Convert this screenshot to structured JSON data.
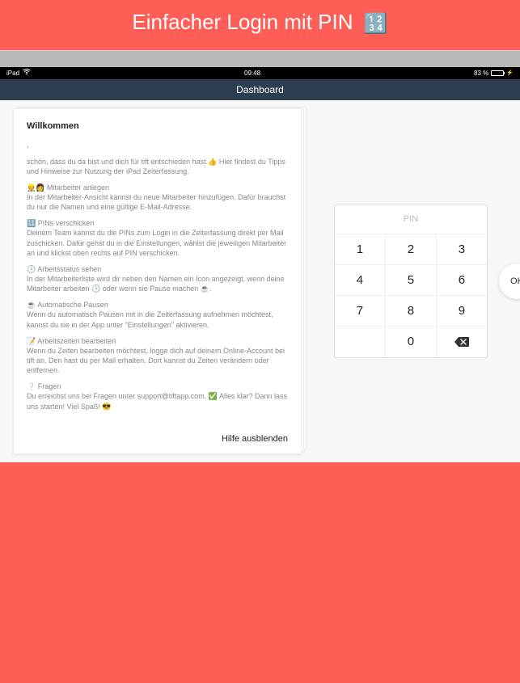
{
  "hero": {
    "title": "Einfacher Login mit PIN",
    "emoji": "🔢"
  },
  "statusbar": {
    "carrier": "iPad",
    "time": "09:48",
    "battery_pct": "83 %"
  },
  "navbar": {
    "title": "Dashboard"
  },
  "card": {
    "title": "Willkommen",
    "greeting": ",",
    "intro": "schön, dass du da bist und dich für tift entschieden hast.👍 Hier findest du Tipps und Hinweise zur Nutzung der iPad Zeiterfassung.",
    "section1_head": "👷👩 Mitarbeiter anlegen",
    "section1_body": "In der Mitarbeiter-Ansicht kannst du neue Mitarbeiter hinzufügen. Dafür brauchst du nur die Namen und eine gültige E-Mail-Adresse.",
    "section2_head": "🔢 PINs verschicken",
    "section2_body": "Deinem Team kannst du die PINs zum Login in die Zeiterfassung direkt per Mail zuschicken. Dafür gehst du in die Einstellungen, wählst die jeweiligen Mitarbeiter an und klickst oben rechts auf PIN verschicken.",
    "section3_head": "🕓 Arbeitsstatus sehen",
    "section3_body": "In der Mitarbeiterliste wird dir neben den Namen ein Icon angezeigt, wenn deine Mitarbeiter arbeiten 🕓 oder wenn sie Pause machen ☕️.",
    "section4_head": "☕️ Automatische Pausen",
    "section4_body": "Wenn du automatisch Pausen mit in die Zeiterfassung aufnehmen möchtest, kannst du sie in der App unter \"Einstellungen\" aktivieren.",
    "section5_head": "📝 Arbeitszeiten bearbeiten",
    "section5_body": "Wenn du Zeiten bearbeiten möchtest, logge dich auf deinem Online-Account bei tift an. Den hast du per Mail erhalten. Dort kannst du Zeiten verändern oder entfernen.",
    "section6_head": "❔ Fragen",
    "section6_body": "Du erreichst uns bei Fragen unter support@tiftapp.com. ✅ Alles klar? Dann lass uns starten! Viel Spaß! 😎",
    "footer": "Hilfe ausblenden"
  },
  "keypad": {
    "placeholder": "PIN",
    "keys": {
      "k1": "1",
      "k2": "2",
      "k3": "3",
      "k4": "4",
      "k5": "5",
      "k6": "6",
      "k7": "7",
      "k8": "8",
      "k9": "9",
      "k0": "0"
    },
    "ok": "OK"
  }
}
